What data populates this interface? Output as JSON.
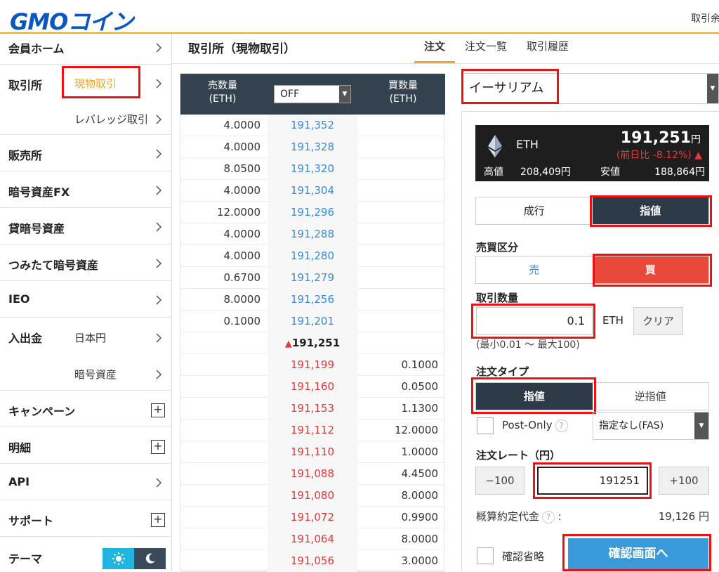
{
  "header": {
    "logo": "GMOコイン",
    "right_text": "取引余"
  },
  "sidebar": {
    "items": [
      {
        "label": "会員ホーム"
      },
      {
        "label": "取引所",
        "sub": "現物取引"
      },
      {
        "sub": "レバレッジ取引"
      },
      {
        "label": "販売所"
      },
      {
        "label": "暗号資産FX"
      },
      {
        "label": "貸暗号資産"
      },
      {
        "label": "つみたて暗号資産"
      },
      {
        "label": "IEO"
      },
      {
        "label": "入出金",
        "sub": "日本円"
      },
      {
        "sub": "暗号資産"
      },
      {
        "label": "キャンペーン"
      },
      {
        "label": "明細"
      },
      {
        "label": "API"
      },
      {
        "label": "サポート"
      },
      {
        "label": "テーマ"
      }
    ]
  },
  "main": {
    "title": "取引所（現物取引）",
    "tabs": [
      "注文",
      "注文一覧",
      "取引履歴"
    ]
  },
  "orderbook": {
    "sell_header": [
      "売数量",
      "(ETH)"
    ],
    "buy_header": [
      "買数量",
      "(ETH)"
    ],
    "filter_value": "OFF",
    "sell_rows": [
      {
        "qty": "4.0000",
        "price": "191,352"
      },
      {
        "qty": "4.0000",
        "price": "191,328"
      },
      {
        "qty": "8.0500",
        "price": "191,320"
      },
      {
        "qty": "4.0000",
        "price": "191,304"
      },
      {
        "qty": "12.0000",
        "price": "191,296"
      },
      {
        "qty": "4.0000",
        "price": "191,288"
      },
      {
        "qty": "4.0000",
        "price": "191,280"
      },
      {
        "qty": "0.6700",
        "price": "191,279"
      },
      {
        "qty": "8.0000",
        "price": "191,256"
      },
      {
        "qty": "0.1000",
        "price": "191,201"
      }
    ],
    "mid_price": "191,251",
    "buy_rows": [
      {
        "price": "191,199",
        "qty": "0.1000"
      },
      {
        "price": "191,160",
        "qty": "0.0500"
      },
      {
        "price": "191,153",
        "qty": "1.1300"
      },
      {
        "price": "191,112",
        "qty": "12.0000"
      },
      {
        "price": "191,110",
        "qty": "1.0000"
      },
      {
        "price": "191,088",
        "qty": "4.4500"
      },
      {
        "price": "191,080",
        "qty": "8.0000"
      },
      {
        "price": "191,072",
        "qty": "0.9900"
      },
      {
        "price": "191,064",
        "qty": "8.0000"
      },
      {
        "price": "191,056",
        "qty": "3.0000"
      }
    ]
  },
  "order": {
    "asset": "イーサリアム",
    "ticker": {
      "symbol": "ETH",
      "price": "191,251",
      "price_unit": "円",
      "change": "(前日比 -8.12%)",
      "high_label": "高値",
      "high": "208,409円",
      "low_label": "安値",
      "low": "188,864円"
    },
    "type_market": "成行",
    "type_limit": "指値",
    "side_label": "売買区分",
    "side_sell": "売",
    "side_buy": "買",
    "qty_label": "取引数量",
    "qty_value": "0.1",
    "qty_unit": "ETH",
    "clear_label": "クリア",
    "qty_hint": "(最小0.01 〜 最大100)",
    "order_type_label": "注文タイプ",
    "order_type_limit": "指値",
    "order_type_stop": "逆指値",
    "post_only": "Post-Only",
    "help": "?",
    "tif_value": "指定なし(FAS)",
    "rate_label": "注文レート（円）",
    "minus": "−100",
    "plus": "+100",
    "rate_value": "191251",
    "est_label": "概算約定代金",
    "est_value": "19,126 円",
    "skip_confirm": "確認省略",
    "confirm": "確認画面へ"
  },
  "colors": {
    "accent": "#f5a623",
    "brand": "#0a57c2",
    "buy": "#e8493b",
    "sell": "#3a8ad6",
    "dark": "#2d3a48",
    "highlight": "#e11111"
  }
}
